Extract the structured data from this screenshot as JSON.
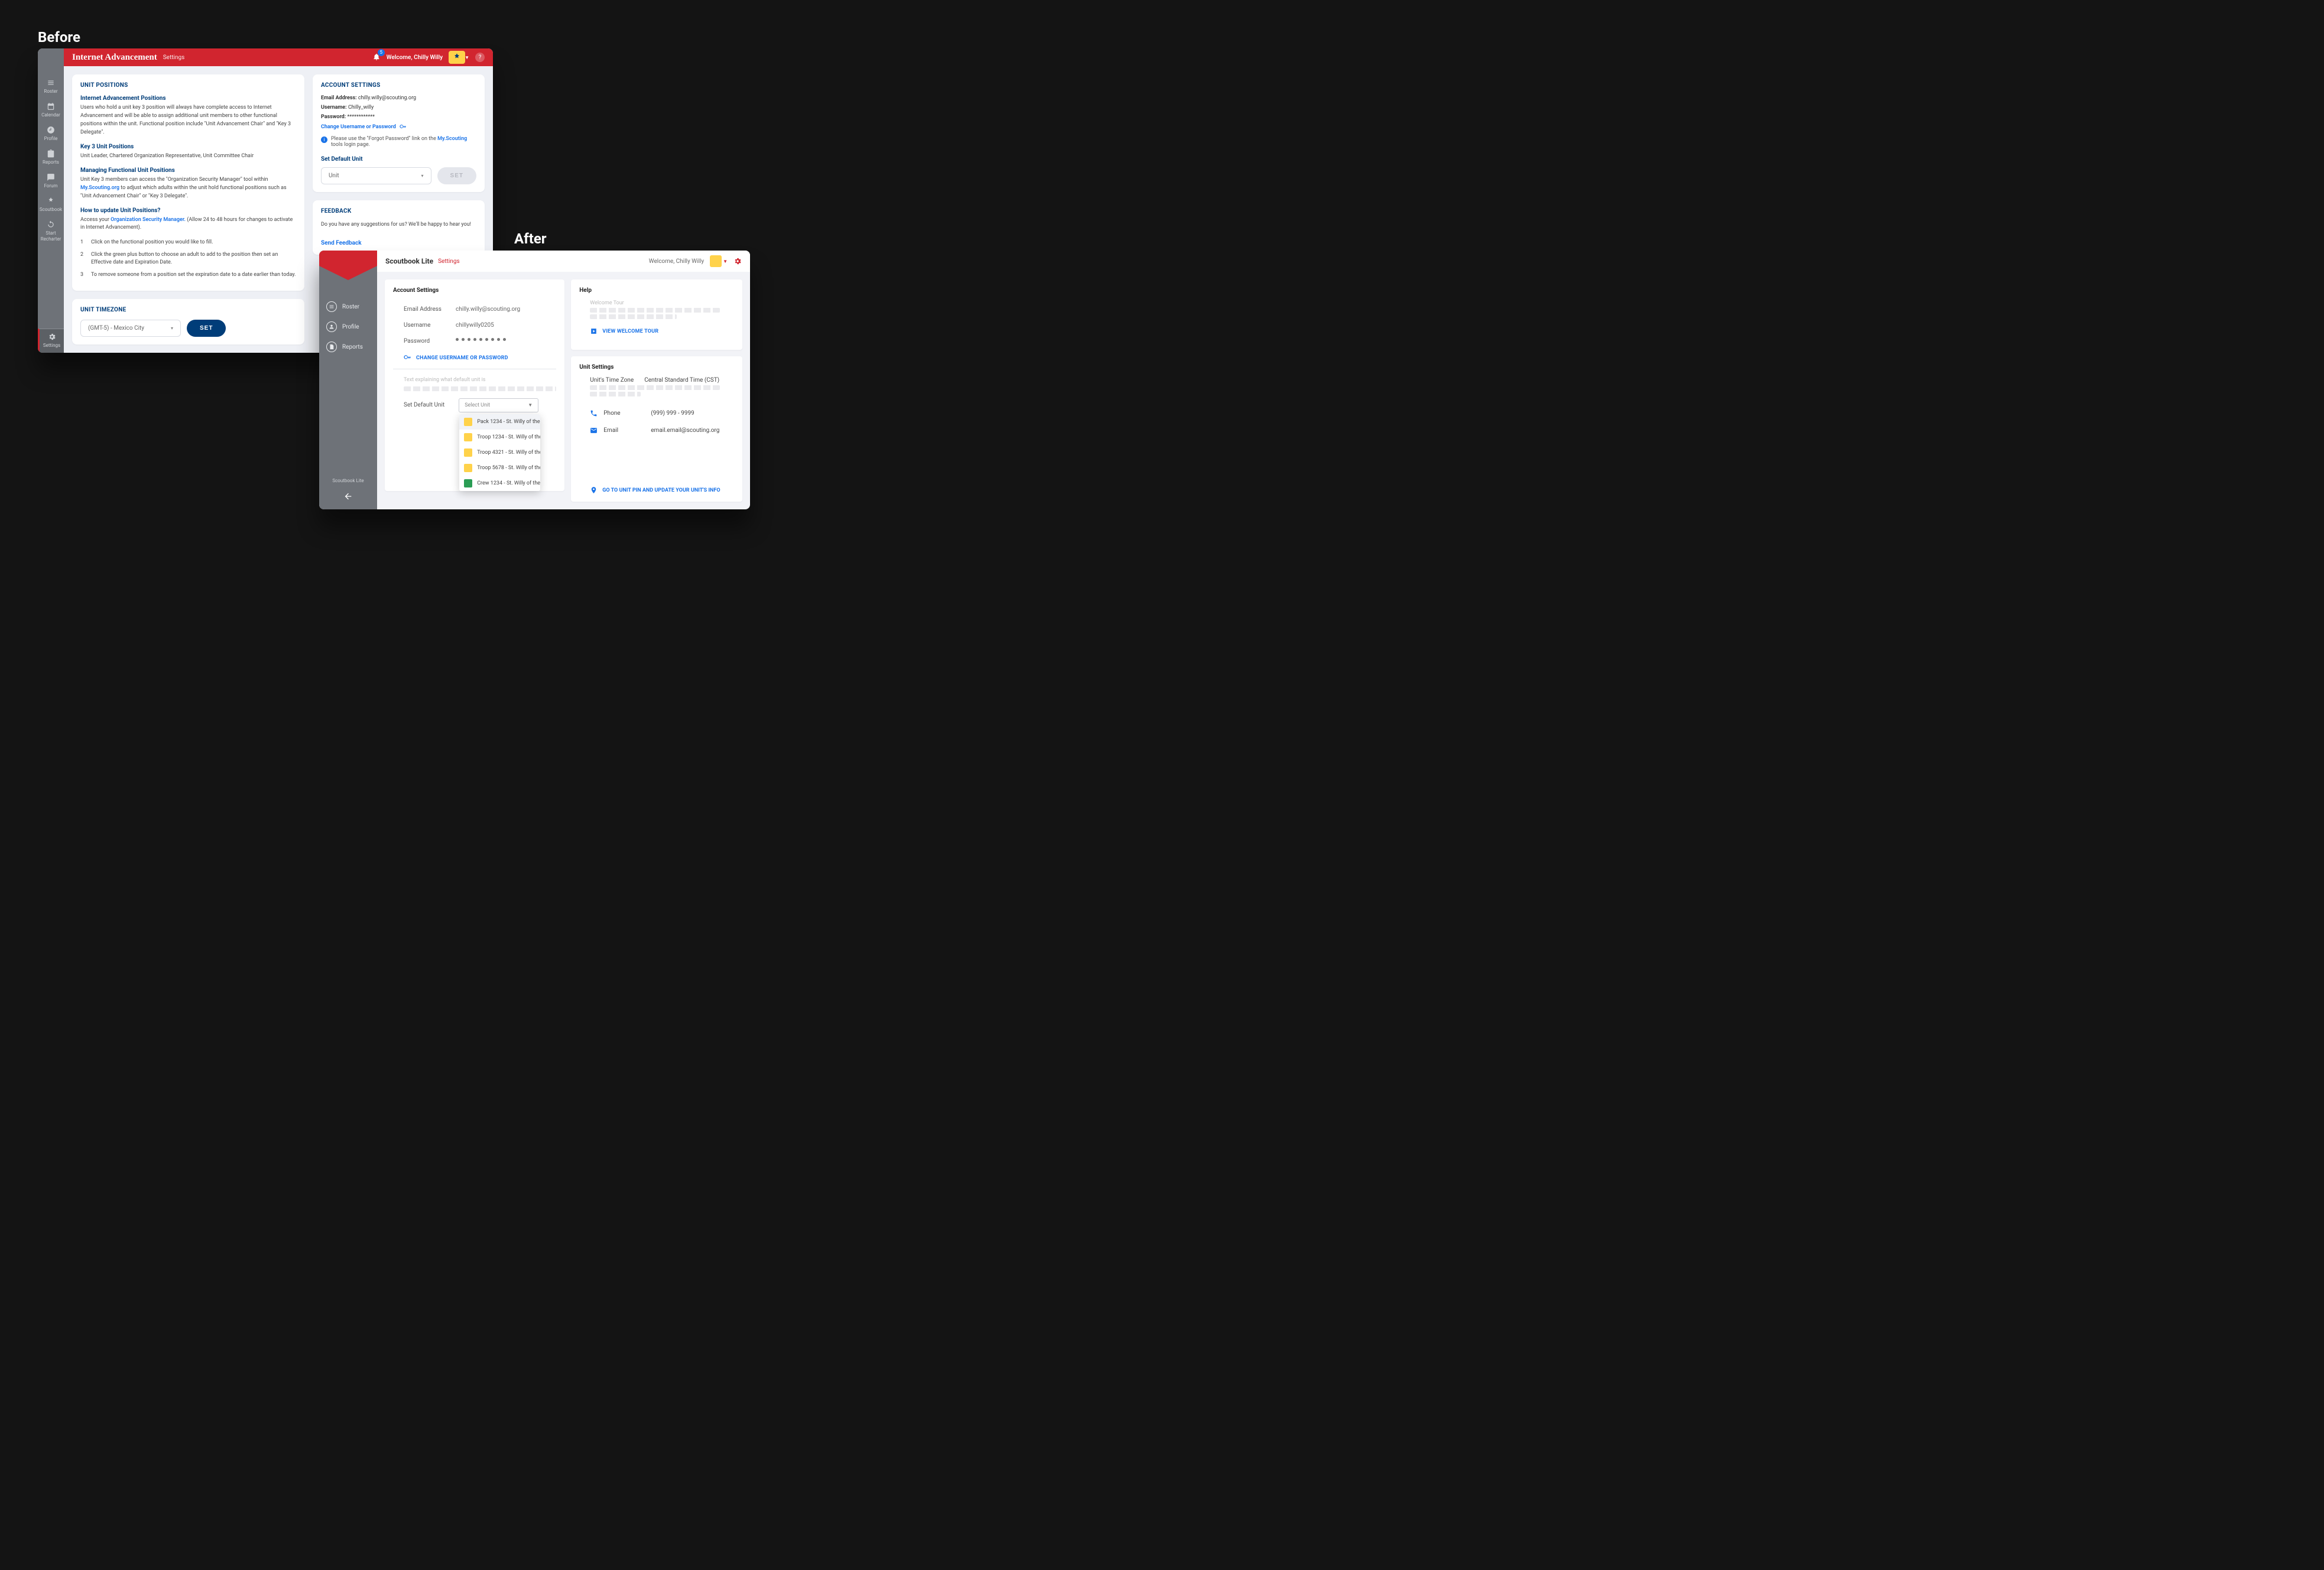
{
  "labels": {
    "before": "Before",
    "after": "After"
  },
  "before": {
    "header": {
      "title": "Internet Advancement",
      "subtitle": "Settings",
      "notif_count": "5",
      "welcome": "Welcome, Chilly Willy"
    },
    "sidebar": {
      "roster": "Roster",
      "calendar": "Calendar",
      "profile": "Profile",
      "reports": "Reports",
      "forum": "Forum",
      "scoutbook": "Scoutbook",
      "recharter": "Start Recharter",
      "settings": "Settings"
    },
    "positions": {
      "heading": "UNIT POSITIONS",
      "iap_h": "Internet Advancement Positions",
      "iap_p": "Users who hold a unit key 3 position will always have complete access to Internet Advancement and will be able to assign additional unit members to other functional positions within the unit. Functional position include \"Unit Advancement Chair\" and \"Key 3 Delegate\".",
      "k3_h": "Key 3 Unit Positions",
      "k3_p": "Unit Leader, Chartered Organization Representative, Unit Committee Chair",
      "mg_h": "Managing Functional Unit Positions",
      "mg_p1": "Unit Key 3 members can access the \"Organization Security Manager\" tool within ",
      "mg_link": "My.Scouting.org",
      "mg_p2": " to adjust which adults within the unit hold functional positions such as \"Unit Advancement Chair\" or \"Key 3 Delegate\".",
      "upd_h": "How to update Unit Positions?",
      "upd_p1": "Access your ",
      "upd_link": "Organization Security Manager.",
      "upd_p2": " (Allow 24 to 48 hours for changes to activate in Internet Advancement).",
      "li1": "Click on the functional position you would like to fill.",
      "li2": "Click the green plus button to choose an adult to add to the position then set an Effective date and Expiration Date.",
      "li3": "To remove someone from a position set the expiration date to a date earlier than today."
    },
    "account": {
      "heading": "ACCOUNT SETTINGS",
      "email_k": "Email Address:",
      "email_v": "chilly.willy@scouting.org",
      "user_k": "Username:",
      "user_v": "Chilly_willy",
      "pass_k": "Password:",
      "pass_v": "************",
      "change": "Change Username or Password",
      "info_p1": "Please use the \"Forgot Password\" link on the ",
      "info_link": "My.Scouting",
      "info_p2": " tools login page.",
      "default_h": "Set Default Unit",
      "unit_placeholder": "Unit",
      "set_btn": "SET"
    },
    "feedback": {
      "heading": "FEEDBACK",
      "p": "Do you have any suggestions for us? We'll be happy to hear you!",
      "link": "Send Feedback"
    },
    "timezone": {
      "heading": "UNIT TIMEZONE",
      "value": "(GMT-5) - Mexico City",
      "set_btn": "SET"
    }
  },
  "after": {
    "header": {
      "brand": "Scoutbook Lite",
      "sub": "Settings",
      "welcome": "Welcome, Chilly Willy"
    },
    "sidebar": {
      "roster": "Roster",
      "profile": "Profile",
      "reports": "Reports",
      "footer": "Scoutbook Lite"
    },
    "account": {
      "heading": "Account Settings",
      "email_k": "Email Address",
      "email_v": "chilly.willy@scouting.org",
      "user_k": "Username",
      "user_v": "chillywilly0205",
      "pass_k": "Password",
      "change": "CHANGE USERNAME OR PASSWORD",
      "placeholder_lead": "Text explaining what default unit is",
      "default_k": "Set Default Unit",
      "select_placeholder": "Select Unit",
      "options": [
        "Pack 1234 - St. Willy of the…",
        "Troop 1234 - St. Willy of the…",
        "Troop 4321 - St. Willy of the…",
        "Troop 5678 - St. Willy of the…",
        "Crew 1234 - St. Willy of the…"
      ]
    },
    "help": {
      "heading": "Help",
      "tour_label": "Welcome Tour",
      "link": "VIEW WELCOME TOUR"
    },
    "unit": {
      "heading": "Unit Settings",
      "tz_k": "Unit's Time Zone",
      "tz_v": "Central Standard Time (CST)",
      "phone_k": "Phone",
      "phone_v": "(999) 999 - 9999",
      "email_k": "Email",
      "email_v": "email.email@scouting.org",
      "go_link": "GO TO UNIT PIN AND UPDATE YOUR UNIT'S INFO"
    }
  }
}
